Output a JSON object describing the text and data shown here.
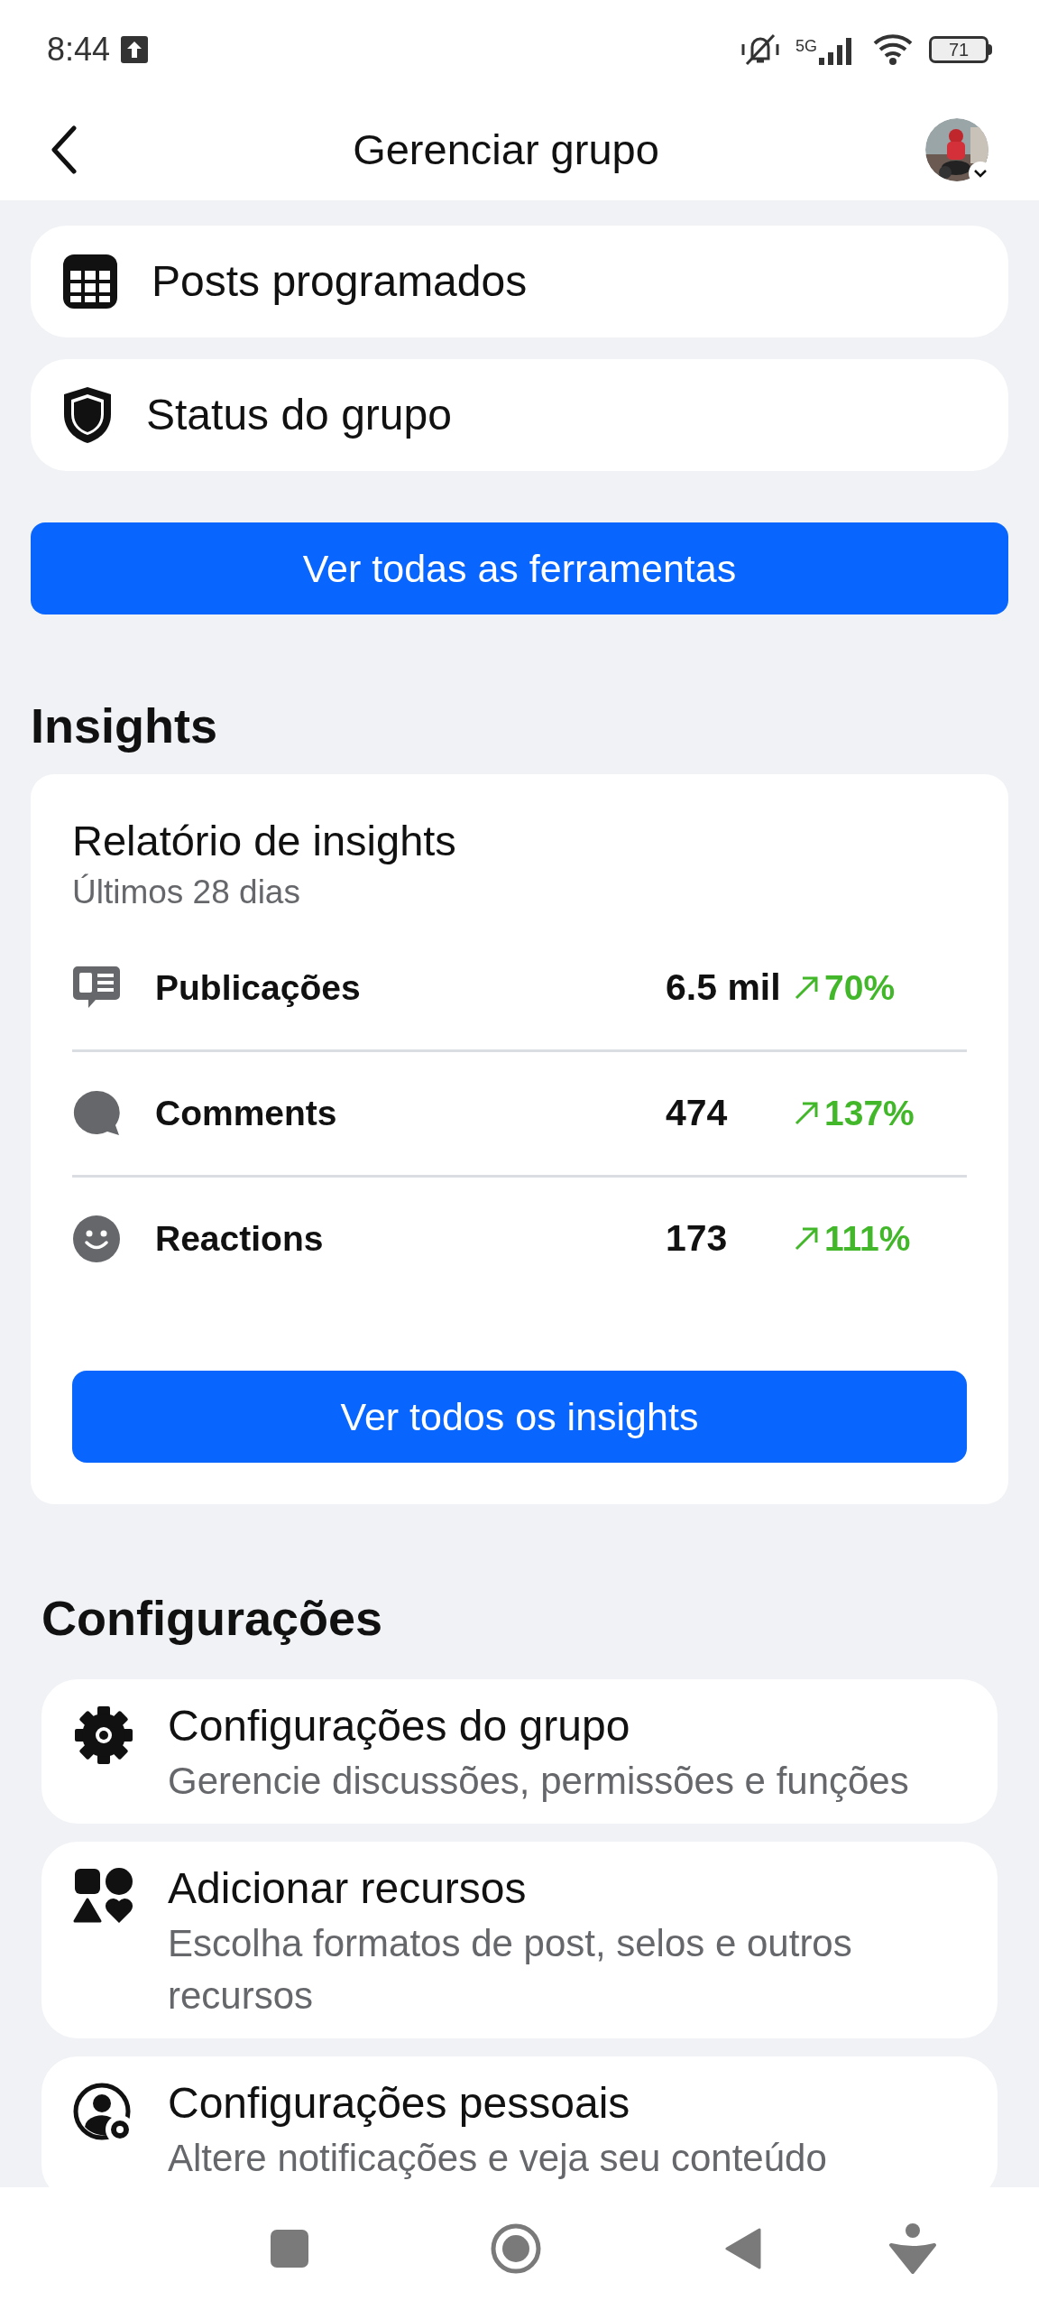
{
  "status_bar": {
    "time": "8:44",
    "network": "5G",
    "battery": "71"
  },
  "header": {
    "title": "Gerenciar grupo"
  },
  "tools": [
    {
      "kind": "calendar",
      "label": "Posts programados"
    },
    {
      "kind": "shield",
      "label": "Status do grupo"
    }
  ],
  "tools_button": "Ver todas as ferramentas",
  "insights": {
    "heading": "Insights",
    "card_title": "Relatório de insights",
    "period": "Últimos 28 dias",
    "metrics": [
      {
        "kind": "posts",
        "label": "Publicações",
        "value": "6.5 mil",
        "change": "70%"
      },
      {
        "kind": "comments",
        "label": "Comments",
        "value": "474",
        "change": "137%"
      },
      {
        "kind": "reactions",
        "label": "Reactions",
        "value": "173",
        "change": "111%"
      }
    ],
    "button": "Ver todos os insights"
  },
  "settings": {
    "heading": "Configurações",
    "items": [
      {
        "kind": "gear",
        "title": "Configurações do grupo",
        "subtitle": "Gerencie discussões, permissões e funções"
      },
      {
        "kind": "shapes",
        "title": "Adicionar recursos",
        "subtitle": "Escolha formatos de post, selos e outros recursos"
      },
      {
        "kind": "person",
        "title": "Configurações pessoais",
        "subtitle": "Altere notificações e veja seu conteúdo"
      }
    ]
  }
}
